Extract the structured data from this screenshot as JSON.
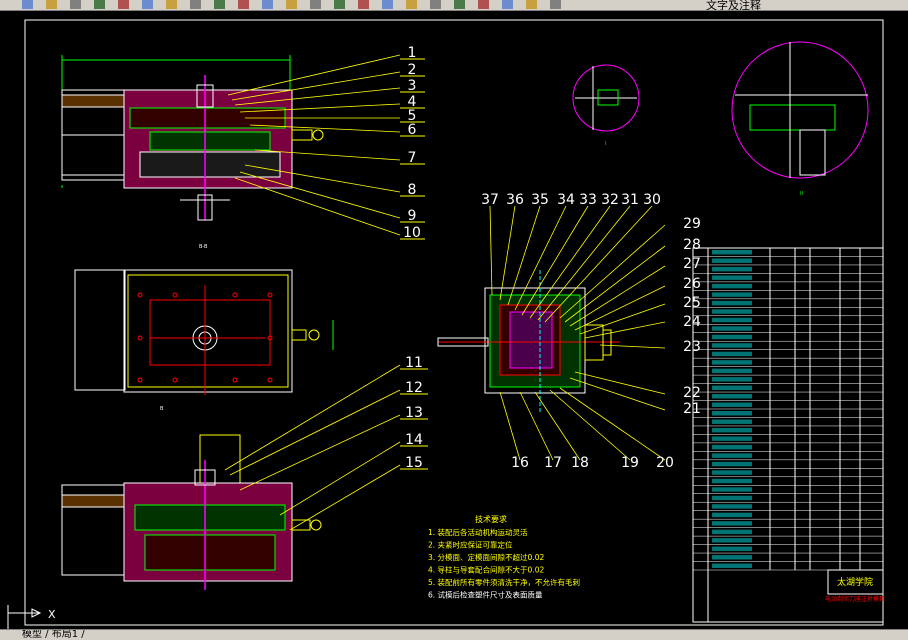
{
  "toolbar": {
    "layer_text": "文字及注释",
    "icons": [
      "open-icon",
      "save-icon",
      "print-icon",
      "preview-icon",
      "publish-icon",
      "cut-icon",
      "copy-icon",
      "paste-icon",
      "match-icon",
      "undo-icon",
      "redo-icon",
      "pan-icon",
      "zoom-realtime-icon",
      "zoom-window-icon",
      "zoom-previous-icon",
      "properties-icon",
      "design-center-icon",
      "tool-palette-icon",
      "sheet-set-icon",
      "markup-icon",
      "calculator-icon",
      "help-icon",
      "layer-manager-icon"
    ]
  },
  "tabs": {
    "model_label": "模型 / 布局1 /"
  },
  "colors": {
    "background": "#000000",
    "outline": "#ffffff",
    "dim": "#00ff00",
    "leader": "#ffff00",
    "hatch": "#ff00ff",
    "section": "#ff0000",
    "center": "#00ffff"
  },
  "balloons_top": [
    "1",
    "2",
    "3",
    "4",
    "5",
    "6",
    "7",
    "8",
    "9",
    "10"
  ],
  "balloons_right_top": [
    "37",
    "36",
    "35",
    "34",
    "33",
    "32",
    "31",
    "30"
  ],
  "balloons_right_side": [
    "29",
    "28",
    "27",
    "26",
    "25",
    "24",
    "23",
    "22",
    "21"
  ],
  "balloons_right_bottom": [
    "16",
    "17",
    "18",
    "19",
    "20"
  ],
  "balloons_bottom": [
    "11",
    "12",
    "13",
    "14",
    "15"
  ],
  "notes": {
    "title": "技术要求",
    "lines": [
      "1. 装配后各活动机构运动灵活",
      "2. 夹紧时应保证可靠定位",
      "3. 分模面、定模面间隙不超过0.02",
      "4. 导柱与导套配合间隙不大于0.02",
      "5. 装配前所有零件须清洗干净，不允许有毛刺",
      "6. 试模后检查塑件尺寸及表面质量"
    ]
  },
  "title_block": {
    "school": "太湖学院",
    "drawing_name": "电动剃须刀座注射模具",
    "rows": 38
  }
}
